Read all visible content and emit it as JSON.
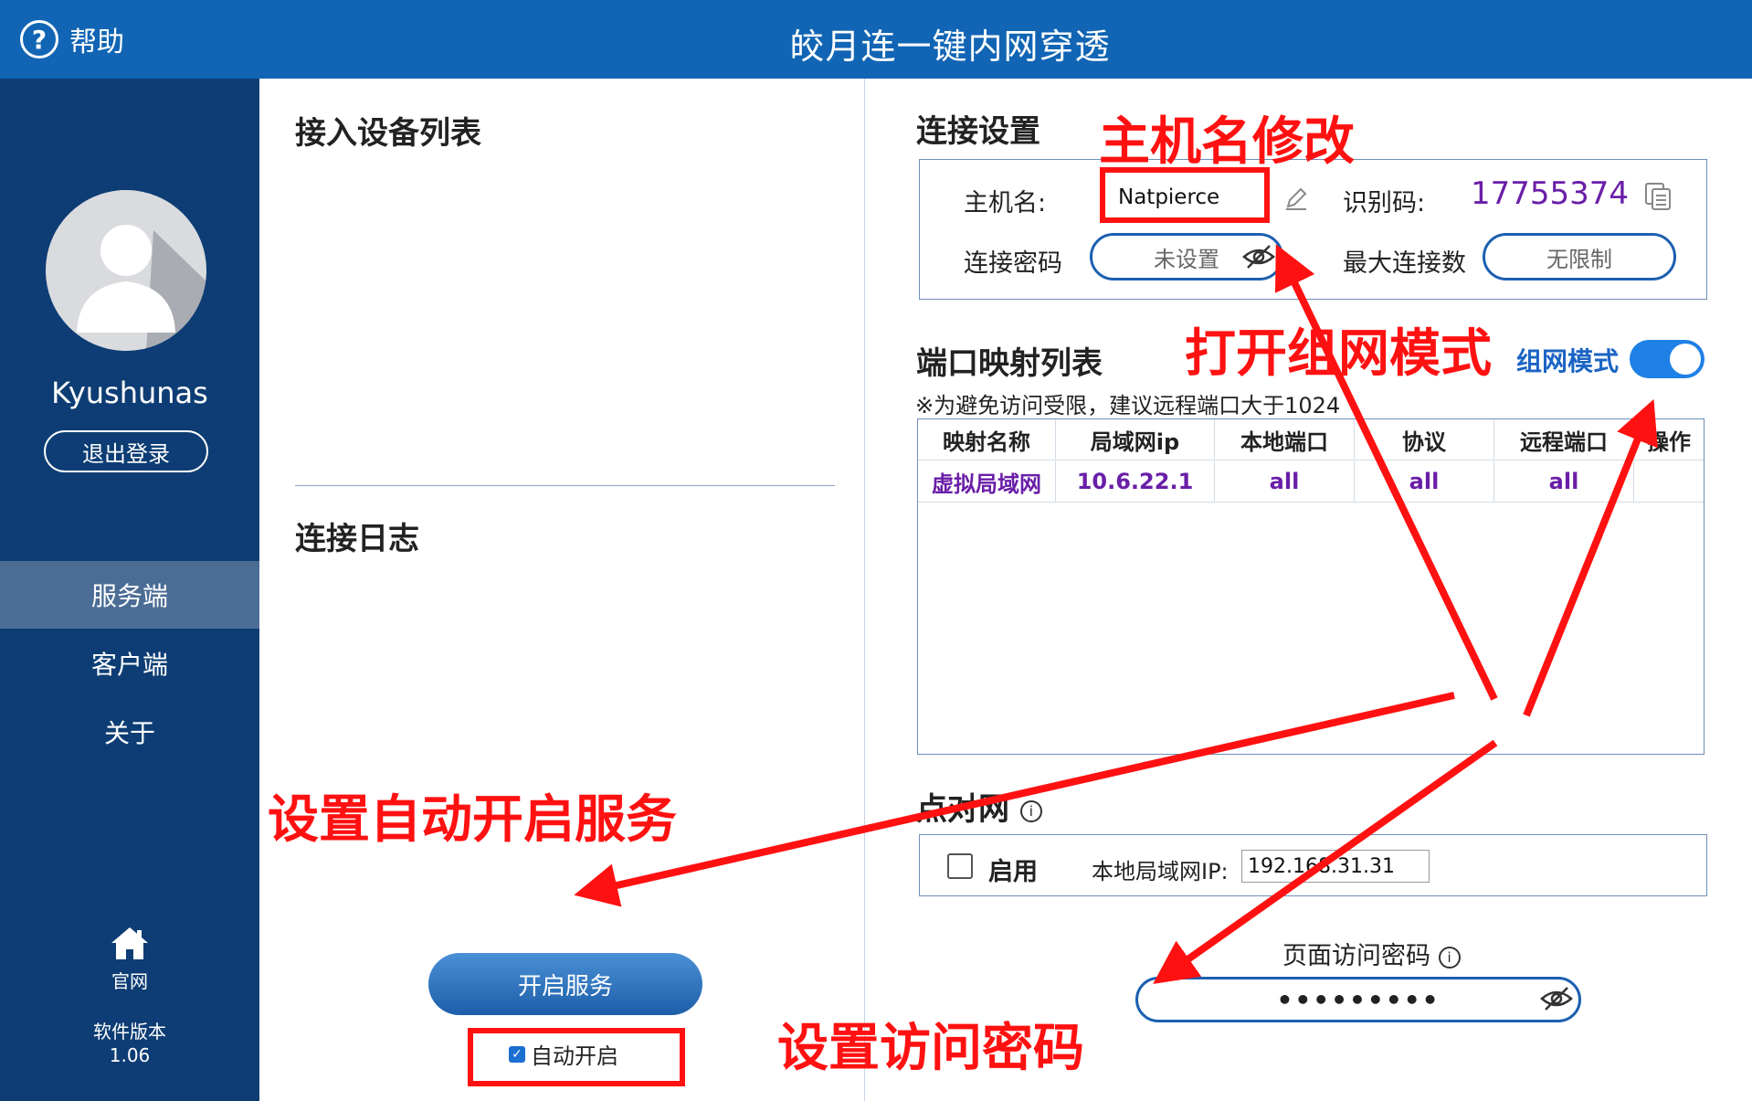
{
  "titlebar": {
    "help_label": "帮助",
    "app_title": "皎月连一键内网穿透"
  },
  "sidebar": {
    "username": "Kyushunas",
    "logout_label": "退出登录",
    "nav": [
      {
        "label": "服务端",
        "active": true
      },
      {
        "label": "客户端",
        "active": false
      },
      {
        "label": "关于",
        "active": false
      }
    ],
    "home_label": "官网",
    "version_label": "软件版本",
    "version_value": "1.06"
  },
  "middle": {
    "devices_title": "接入设备列表",
    "log_title": "连接日志",
    "start_button": "开启服务",
    "auto_start_label": "自动开启",
    "auto_start_checked": true
  },
  "right": {
    "connection_title": "连接设置",
    "hostname_label": "主机名:",
    "hostname_value": "Natpierce",
    "id_label": "识别码:",
    "id_value": "17755374",
    "password_label": "连接密码",
    "password_value": "未设置",
    "max_conn_label": "最大连接数",
    "max_conn_value": "无限制",
    "port_map_title": "端口映射列表",
    "network_mode_label": "组网模式",
    "network_mode_on": true,
    "note": "※为避免访问受限，建议远程端口大于1024",
    "table": {
      "headers": [
        "映射名称",
        "局域网ip",
        "本地端口",
        "协议",
        "远程端口",
        "操作"
      ],
      "rows": [
        [
          "虚拟局域网",
          "10.6.22.1",
          "all",
          "all",
          "all",
          ""
        ]
      ]
    },
    "p2p_title": "点对网",
    "p2p_enable_label": "启用",
    "p2p_enabled": false,
    "local_lan_ip_label": "本地局域网IP:",
    "local_lan_ip_value": "192.168.31.31",
    "page_password_label": "页面访问密码",
    "page_password_value": "•••••••••"
  },
  "annotations": {
    "hostname_edit": "主机名修改",
    "open_network_mode": "打开组网模式",
    "auto_start_service": "设置自动开启服务",
    "set_access_password": "设置访问密码",
    "color": "#ff1111"
  },
  "colors": {
    "titlebar": "#1165b4",
    "sidebar": "#0d3d74",
    "sidebar_active": "#4b6d95",
    "accent": "#1f80e6",
    "purple": "#6a1ea8"
  }
}
